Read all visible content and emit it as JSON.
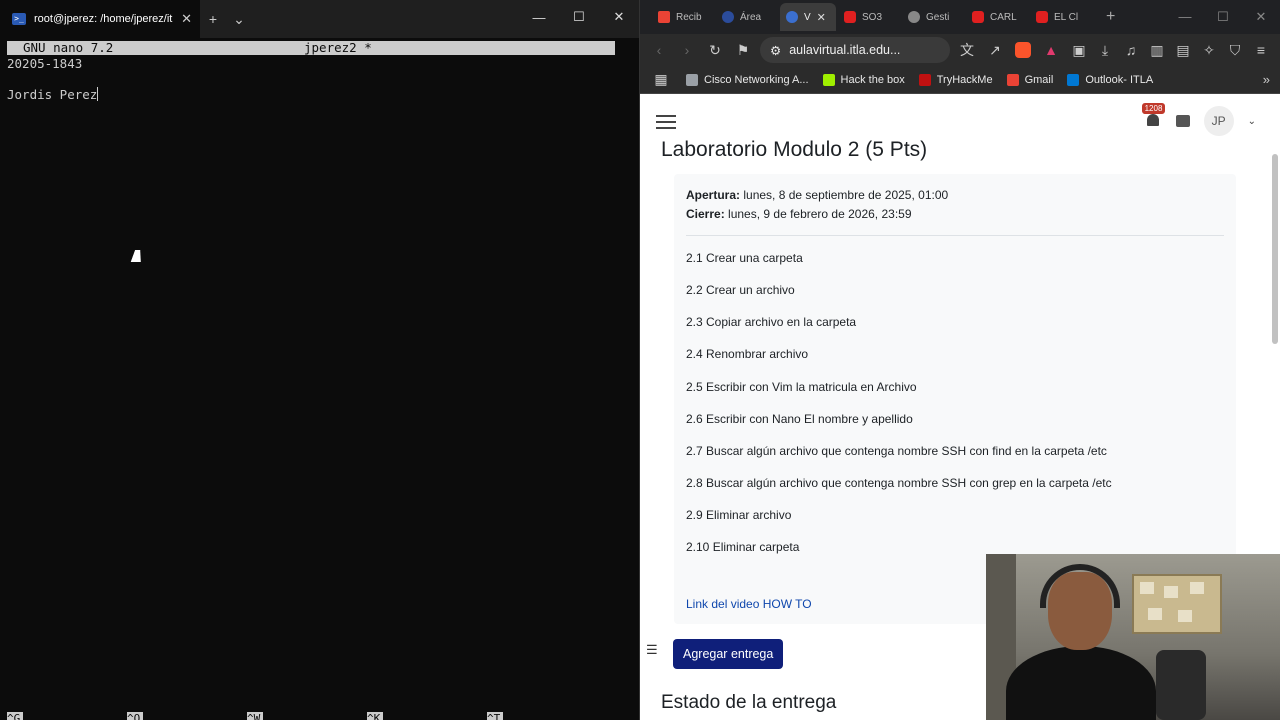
{
  "terminal": {
    "tab_title": "root@jperez: /home/jperez/it",
    "nano_version": "GNU nano 7.2",
    "nano_file": "jperez2 *",
    "lines": [
      "20205-1843",
      "",
      "Jordis Perez"
    ],
    "shortcuts": [
      "^G",
      "^O",
      "^W",
      "^K",
      "^T"
    ]
  },
  "browser": {
    "tabs": [
      {
        "label": "Recib",
        "icon": "gmail-icon"
      },
      {
        "label": "Área",
        "icon": "area-icon"
      },
      {
        "label": "V",
        "icon": "aulavirtual-icon",
        "active": true
      },
      {
        "label": "SO3",
        "icon": "youtube-icon"
      },
      {
        "label": "Gesti",
        "icon": "gear-icon"
      },
      {
        "label": "CARL",
        "icon": "youtube-icon"
      },
      {
        "label": "EL Cl",
        "icon": "youtube-icon"
      }
    ],
    "url": "aulavirtual.itla.edu...",
    "bookmarks": [
      {
        "label": "Cisco Networking A...",
        "color": "#9aa0a6"
      },
      {
        "label": "Hack the box",
        "color": "#9fef00"
      },
      {
        "label": "TryHackMe",
        "color": "#c11111"
      },
      {
        "label": "Gmail",
        "color": "#ea4335"
      },
      {
        "label": "Outlook- ITLA",
        "color": "#0078d4"
      }
    ]
  },
  "moodle": {
    "notification_count": "1208",
    "avatar_initials": "JP",
    "title": "Laboratorio Modulo 2 (5 Pts)",
    "opening_label": "Apertura:",
    "opening_value": "lunes, 8 de septiembre de 2025, 01:00",
    "closing_label": "Cierre:",
    "closing_value": "lunes, 9 de febrero de 2026, 23:59",
    "tasks": [
      "2.1 Crear una carpeta",
      "2.2 Crear un archivo",
      "2.3 Copiar archivo en la carpeta",
      "2.4 Renombrar archivo",
      "2.5 Escribir con Vim la matricula en Archivo",
      "2.6 Escribir con Nano El nombre y apellido",
      "2.7 Buscar algún archivo que contenga nombre SSH con find en la carpeta /etc",
      "2.8 Buscar algún archivo que contenga nombre SSH con grep en la carpeta /etc",
      "2.9 Eliminar archivo",
      "2.10 Eliminar carpeta"
    ],
    "video_link": "Link del video HOW TO",
    "submit_button": "Agregar entrega",
    "status_title": "Estado de la entrega"
  }
}
